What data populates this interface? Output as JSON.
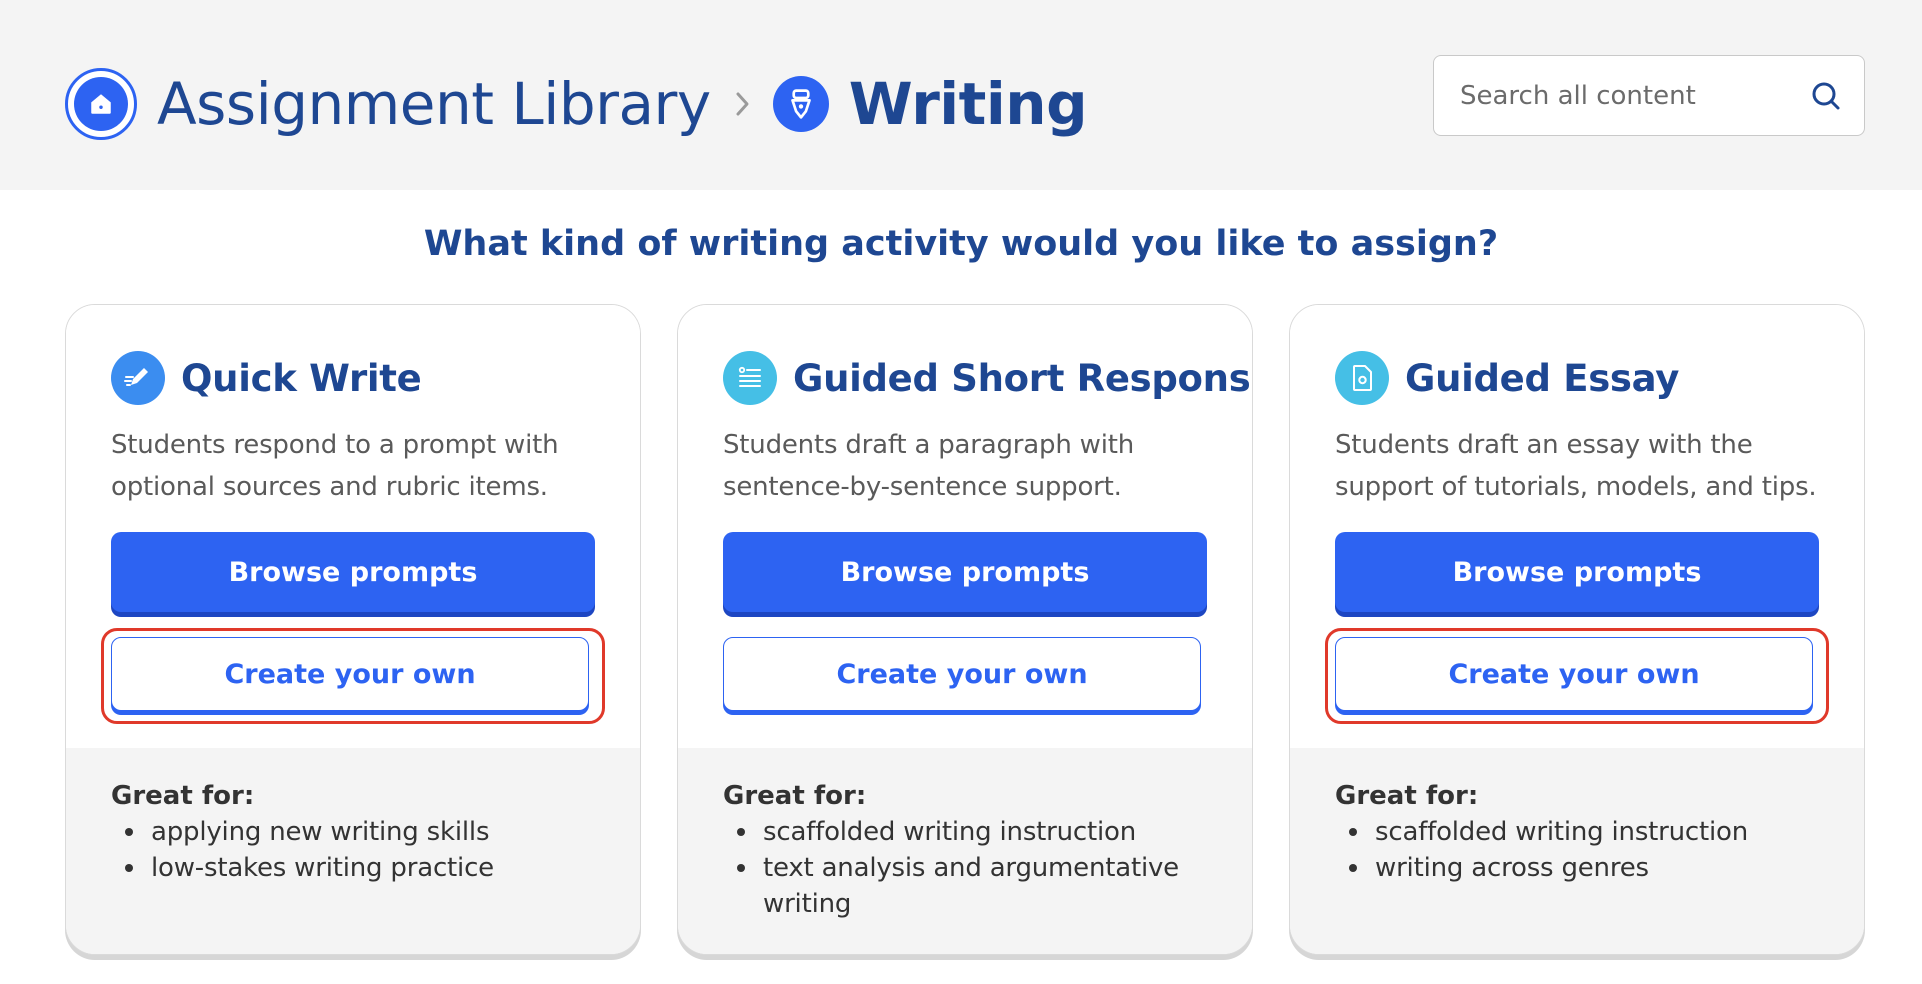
{
  "header": {
    "breadcrumb_root": "Assignment Library",
    "breadcrumb_current": "Writing",
    "search_placeholder": "Search all content"
  },
  "question": "What kind of writing activity would you like to assign?",
  "cards": [
    {
      "title": "Quick Write",
      "icon": "pencil-icon",
      "icon_color": "#3b8df0",
      "description": "Students respond to a prompt with optional sources and rubric items.",
      "primary_label": "Browse prompts",
      "secondary_label": "Create your own",
      "great_for_label": "Great for:",
      "great_for": [
        "applying new writing skills",
        "low-stakes writing practice"
      ]
    },
    {
      "title": "Guided Short Response",
      "icon": "document-list-icon",
      "icon_color": "#45bfe6",
      "description": "Students draft a paragraph with sentence-by-sentence support.",
      "primary_label": "Browse prompts",
      "secondary_label": "Create your own",
      "great_for_label": "Great for:",
      "great_for": [
        "scaffolded writing instruction",
        "text analysis and argumentative writing"
      ]
    },
    {
      "title": "Guided Essay",
      "icon": "document-gear-icon",
      "icon_color": "#45bfe6",
      "description": "Students draft an essay with the support of tutorials, models, and tips.",
      "primary_label": "Browse prompts",
      "secondary_label": "Create your own",
      "great_for_label": "Great for:",
      "great_for": [
        "scaffolded writing instruction",
        "writing across genres"
      ]
    }
  ],
  "colors": {
    "brand_blue": "#2d63f2",
    "heading_navy": "#1e4792",
    "highlight_red": "#e0392a"
  }
}
